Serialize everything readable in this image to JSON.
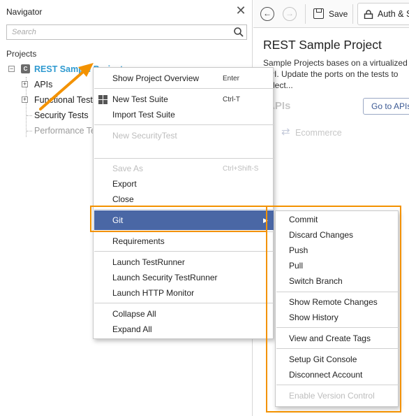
{
  "navigator": {
    "title": "Navigator",
    "close_glyph": "✕",
    "search_placeholder": "Search",
    "projects_label": "Projects",
    "tree": {
      "project": {
        "icon_letter": "C",
        "name": "REST Sample Project"
      },
      "children": [
        {
          "label": "APIs",
          "expandable": true
        },
        {
          "label": "Functional Tests",
          "expandable": true
        },
        {
          "label": "Security Tests",
          "expandable": false
        },
        {
          "label": "Performance Tests",
          "expandable": false
        }
      ]
    }
  },
  "editor": {
    "toolbar": {
      "back_glyph": "←",
      "forward_glyph": "→",
      "save_label": "Save",
      "auth_label": "Auth & Security"
    },
    "project_title": "REST Sample Project",
    "description": "Sample Projects bases on a virtualized API. Update the ports on the tests to reflect...",
    "apis_heading": "APIs",
    "goto_apis_label": "Go to APIs",
    "api_items": [
      {
        "label": "Ecommerce",
        "icon": "exchange-arrows-icon"
      }
    ]
  },
  "context_menu": {
    "items": [
      {
        "label": "Show Project Overview",
        "shortcut": "Enter",
        "enabled": true
      },
      {
        "label": "New Test Suite",
        "shortcut": "Ctrl-T",
        "enabled": true,
        "icon": "grid-icon"
      },
      {
        "label": "Import Test Suite",
        "shortcut": "",
        "enabled": true
      },
      {
        "label": "New SecurityTest",
        "shortcut": "",
        "enabled": false
      },
      {
        "label": "Save As",
        "shortcut": "Ctrl+Shift-S",
        "enabled": false
      },
      {
        "label": "Export",
        "shortcut": "",
        "enabled": true
      },
      {
        "label": "Close",
        "shortcut": "",
        "enabled": true
      },
      {
        "label": "Git",
        "shortcut": "",
        "enabled": true,
        "highlighted": true,
        "has_submenu": true
      },
      {
        "label": "Requirements",
        "shortcut": "",
        "enabled": true
      },
      {
        "label": "Launch TestRunner",
        "shortcut": "",
        "enabled": true
      },
      {
        "label": "Launch Security TestRunner",
        "shortcut": "",
        "enabled": true
      },
      {
        "label": "Launch HTTP Monitor",
        "shortcut": "",
        "enabled": true
      },
      {
        "label": "Collapse All",
        "shortcut": "",
        "enabled": true
      },
      {
        "label": "Expand All",
        "shortcut": "",
        "enabled": true
      }
    ],
    "submenu_arrow_glyph": "▶"
  },
  "git_submenu": {
    "items": [
      {
        "label": "Commit",
        "enabled": true
      },
      {
        "label": "Discard Changes",
        "enabled": true
      },
      {
        "label": "Push",
        "enabled": true
      },
      {
        "label": "Pull",
        "enabled": true
      },
      {
        "label": "Switch Branch",
        "enabled": true
      },
      {
        "label": "Show Remote Changes",
        "enabled": true
      },
      {
        "label": "Show History",
        "enabled": true
      },
      {
        "label": "View and Create Tags",
        "enabled": true
      },
      {
        "label": "Setup Git Console",
        "enabled": true
      },
      {
        "label": "Disconnect Account",
        "enabled": true
      },
      {
        "label": "Enable Version Control",
        "enabled": false
      }
    ]
  },
  "annotation_color": "#f39200",
  "accent_color": "#4a67a5"
}
